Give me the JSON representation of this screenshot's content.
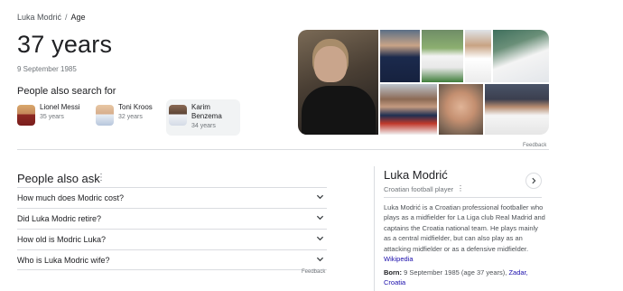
{
  "breadcrumb": {
    "entity": "Luka Modrić",
    "separator": "/",
    "attribute": "Age"
  },
  "answer": {
    "value": "37 years",
    "date": "9 September 1985"
  },
  "people_also_search": {
    "title": "People also search for",
    "items": [
      {
        "name": "Lionel Messi",
        "age": "35 years",
        "color": "#b03a2e"
      },
      {
        "name": "Toni Kroos",
        "age": "32 years",
        "color": "#7a9cc6"
      },
      {
        "name_line1": "Karim",
        "name_line2": "Benzema",
        "age": "34 years",
        "color": "#3f6fb5"
      }
    ]
  },
  "gallery": {
    "photos": [
      {
        "name": "photo-main",
        "label": "portrait"
      },
      {
        "name": "photo-croatia-kit",
        "label": "croatia kit"
      },
      {
        "name": "photo-real-madrid-pitch",
        "label": "real madrid pitch"
      },
      {
        "name": "photo-real-madrid-portrait",
        "label": "real madrid portrait"
      },
      {
        "name": "photo-celebration",
        "label": "celebration"
      },
      {
        "name": "photo-croatia-portrait",
        "label": "croatia portrait"
      },
      {
        "name": "photo-closeup",
        "label": "close-up"
      },
      {
        "name": "photo-real-madrid-action",
        "label": "real madrid action"
      }
    ],
    "feedback": "Feedback"
  },
  "people_also_ask": {
    "title": "People also ask",
    "questions": [
      "How much does Modric cost?",
      "Did Luka Modric retire?",
      "How old is Modric Luka?",
      "Who is Luka Modric wife?"
    ],
    "feedback": "Feedback"
  },
  "knowledge_panel": {
    "title": "Luka Modrić",
    "subtitle": "Croatian football player",
    "description": "Luka Modrić is a Croatian professional footballer who plays as a midfielder for La Liga club Real Madrid and captains the Croatia national team. He plays mainly as a central midfielder, but can also play as an attacking midfielder or as a defensive midfielder.",
    "source": "Wikipedia",
    "born_label": "Born:",
    "born_value": "9 September 1985 (age 37 years),",
    "born_place_1": "Zadar,",
    "born_place_2": "Croatia"
  },
  "colors": {
    "link": "#1a0dab",
    "divider": "#dadce0",
    "muted": "#70757a"
  }
}
